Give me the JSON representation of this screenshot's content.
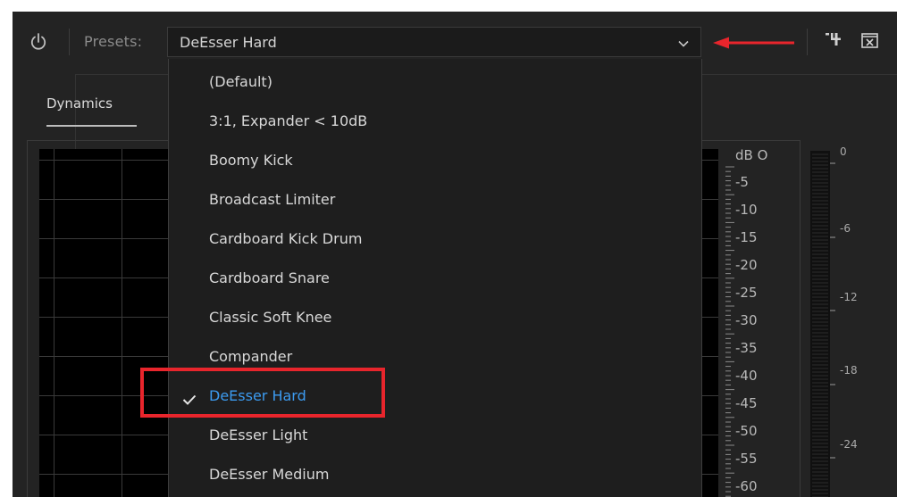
{
  "toolbar": {
    "presets_label": "Presets:",
    "selected_preset": "DeEsser Hard"
  },
  "tabs": [
    {
      "label": "Dynamics"
    }
  ],
  "scale": {
    "unit_label": "dB O",
    "values": [
      "-5",
      "-10",
      "-15",
      "-20",
      "-25",
      "-30",
      "-35",
      "-40",
      "-45",
      "-50",
      "-55",
      "-60"
    ]
  },
  "meter": {
    "values": [
      "0",
      "-6",
      "-12",
      "-18",
      "-24"
    ]
  },
  "dropdown": {
    "items": [
      {
        "label": "(Default)",
        "selected": false
      },
      {
        "label": "3:1, Expander < 10dB",
        "selected": false
      },
      {
        "label": "Boomy Kick",
        "selected": false
      },
      {
        "label": "Broadcast Limiter",
        "selected": false
      },
      {
        "label": "Cardboard Kick Drum",
        "selected": false
      },
      {
        "label": "Cardboard Snare",
        "selected": false
      },
      {
        "label": "Classic Soft Knee",
        "selected": false
      },
      {
        "label": "Compander",
        "selected": false
      },
      {
        "label": "DeEsser Hard",
        "selected": true
      },
      {
        "label": "DeEsser Light",
        "selected": false
      },
      {
        "label": "DeEsser Medium",
        "selected": false
      }
    ]
  },
  "colors": {
    "background": "#232323",
    "accent_selected": "#3c9bf0",
    "annotation_red": "#e8252c"
  },
  "icons": [
    "power-icon",
    "chevron-down-icon",
    "routing-icon",
    "close-panel-icon",
    "checkmark-icon",
    "red-arrow-annotation"
  ]
}
